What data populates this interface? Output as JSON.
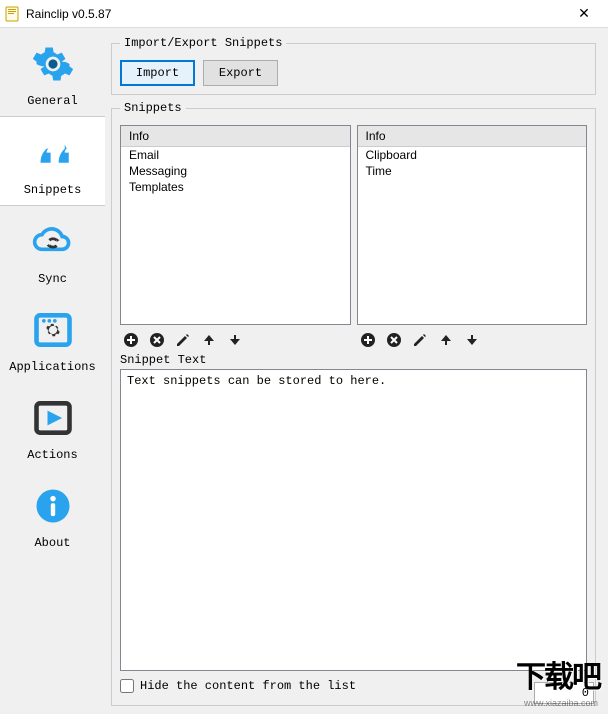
{
  "window": {
    "title": "Rainclip v0.5.87",
    "close": "✕"
  },
  "sidebar": {
    "items": [
      {
        "label": "General"
      },
      {
        "label": "Snippets"
      },
      {
        "label": "Sync"
      },
      {
        "label": "Applications"
      },
      {
        "label": "Actions"
      },
      {
        "label": "About"
      }
    ],
    "selected_index": 1
  },
  "import_export": {
    "legend": "Import/Export Snippets",
    "import_btn": "Import",
    "export_btn": "Export"
  },
  "snippets": {
    "legend": "Snippets",
    "list_left": {
      "header": "Info",
      "rows": [
        "Email",
        "Messaging",
        "Templates"
      ]
    },
    "list_right": {
      "header": "Info",
      "rows": [
        "Clipboard",
        "Time"
      ]
    },
    "snippet_text_label": "Snippet Text",
    "snippet_text": "Text snippets can be stored to here.",
    "hide_checkbox_label": "Hide the content from the list",
    "hide_checked": false
  },
  "footer": {
    "number_value": "0"
  },
  "watermark": {
    "cn": "下载吧",
    "url": "www.xiazaiba.com"
  }
}
